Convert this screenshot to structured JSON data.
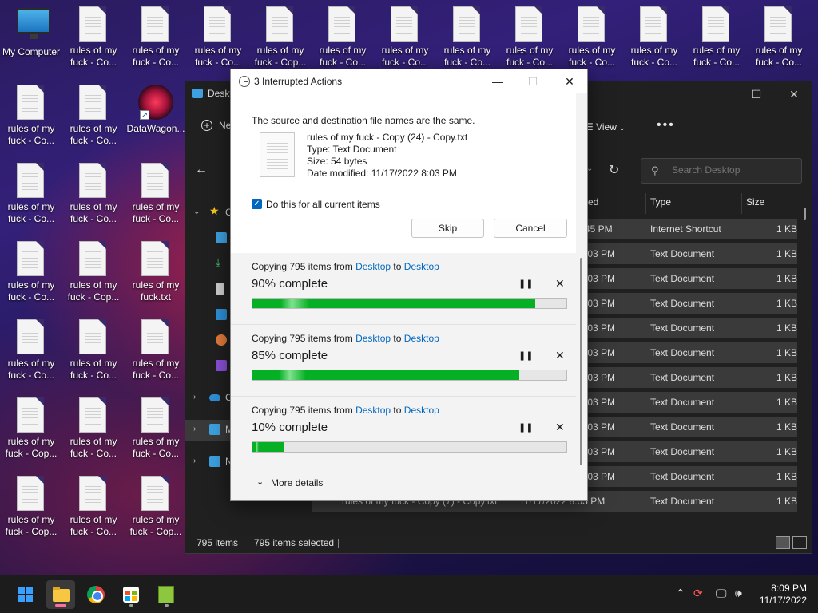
{
  "desktop": {
    "icons": [
      {
        "label": "My Computer",
        "icon": "computer-icon"
      },
      {
        "label": "rules of my fuck - Co...",
        "icon": "text-file-icon"
      },
      {
        "label": "rules of my fuck - Co...",
        "icon": "text-file-icon"
      },
      {
        "label": "rules of my fuck - Co...",
        "icon": "text-file-icon"
      },
      {
        "label": "rules of my fuck - Cop...",
        "icon": "text-file-icon"
      },
      {
        "label": "rules of my fuck - Co...",
        "icon": "text-file-icon"
      },
      {
        "label": "rules of my fuck - Co...",
        "icon": "text-file-icon"
      },
      {
        "label": "rules of my fuck - Co...",
        "icon": "text-file-icon"
      },
      {
        "label": "rules of my fuck - Co...",
        "icon": "text-file-icon"
      },
      {
        "label": "rules of my fuck - Co...",
        "icon": "text-file-icon"
      },
      {
        "label": "rules of my fuck - Co...",
        "icon": "text-file-icon"
      },
      {
        "label": "rules of my fuck - Co...",
        "icon": "text-file-icon"
      },
      {
        "label": "rules of my fuck - Co...",
        "icon": "text-file-icon"
      },
      {
        "label": "rules of my fuck - Co...",
        "icon": "text-file-icon"
      },
      {
        "label": "rules of my fuck - Co...",
        "icon": "text-file-icon"
      },
      {
        "label": "DataWagon...",
        "icon": "datawagon-shortcut-icon"
      },
      {
        "label": "rules of my fuck - Co...",
        "icon": "text-file-icon"
      },
      {
        "label": "rules of my fuck - Co...",
        "icon": "text-file-icon"
      },
      {
        "label": "rules of my fuck - Co...",
        "icon": "text-file-icon"
      },
      {
        "label": "rules of my fuck - Co...",
        "icon": "text-file-icon"
      },
      {
        "label": "rules of my fuck - Cop...",
        "icon": "text-file-icon"
      },
      {
        "label": "rules of my fuck.txt",
        "icon": "text-file-icon"
      },
      {
        "label": "rules of my fuck - Co...",
        "icon": "text-file-icon"
      },
      {
        "label": "rules of my fuck - Co...",
        "icon": "text-file-icon"
      },
      {
        "label": "rules of my fuck - Co...",
        "icon": "text-file-icon"
      },
      {
        "label": "rules of my fuck - Cop...",
        "icon": "text-file-icon"
      },
      {
        "label": "rules of my fuck - Co...",
        "icon": "text-file-icon"
      },
      {
        "label": "rules of my fuck - Co...",
        "icon": "text-file-icon"
      },
      {
        "label": "rules of my fuck - Cop...",
        "icon": "text-file-icon"
      },
      {
        "label": "rules of my fuck - Co...",
        "icon": "text-file-icon"
      },
      {
        "label": "rules of my fuck - Cop...",
        "icon": "text-file-icon"
      }
    ]
  },
  "explorer": {
    "title": "Deskt",
    "new_label": "Ne",
    "view_label": "View",
    "more_label": "•••",
    "search_placeholder": "Search Desktop",
    "sidebar_items": [
      "C",
      "C",
      "M",
      "N"
    ],
    "columns": {
      "date": "ed",
      "type": "Type",
      "size": "Size"
    },
    "rows": [
      {
        "name": "",
        "date": "45 PM",
        "type": "Internet Shortcut",
        "size": "1 KB"
      },
      {
        "name": "",
        "date": ":03 PM",
        "type": "Text Document",
        "size": "1 KB"
      },
      {
        "name": "",
        "date": ":03 PM",
        "type": "Text Document",
        "size": "1 KB"
      },
      {
        "name": "",
        "date": ":03 PM",
        "type": "Text Document",
        "size": "1 KB"
      },
      {
        "name": "",
        "date": ":03 PM",
        "type": "Text Document",
        "size": "1 KB"
      },
      {
        "name": "",
        "date": ":03 PM",
        "type": "Text Document",
        "size": "1 KB"
      },
      {
        "name": "",
        "date": ":03 PM",
        "type": "Text Document",
        "size": "1 KB"
      },
      {
        "name": "",
        "date": ":03 PM",
        "type": "Text Document",
        "size": "1 KB"
      },
      {
        "name": "",
        "date": ":03 PM",
        "type": "Text Document",
        "size": "1 KB"
      },
      {
        "name": "",
        "date": ":03 PM",
        "type": "Text Document",
        "size": "1 KB"
      },
      {
        "name": "",
        "date": ":03 PM",
        "type": "Text Document",
        "size": "1 KB"
      },
      {
        "name": "rules of my fuck - Copy (7) - Copy.txt",
        "date": "11/17/2022 8:03 PM",
        "type": "Text Document",
        "size": "1 KB"
      }
    ],
    "status_count": "795 items",
    "status_selected": "795 items selected"
  },
  "dialog": {
    "title": "3 Interrupted Actions",
    "message": "The source and destination file names are the same.",
    "file_name": "rules of my fuck - Copy (24) - Copy.txt",
    "file_type": "Type: Text Document",
    "file_size": "Size: 54 bytes",
    "file_modified": "Date modified: 11/17/2022 8:03 PM",
    "checkbox_label": "Do this for all current items",
    "checkbox_checked": true,
    "skip_label": "Skip",
    "cancel_label": "Cancel",
    "operations": [
      {
        "prefix": "Copying 795 items from ",
        "source": "Desktop",
        "to": " to ",
        "dest": "Desktop",
        "percent_label": "90% complete",
        "progress": 0.9
      },
      {
        "prefix": "Copying 795 items from ",
        "source": "Desktop",
        "to": " to ",
        "dest": "Desktop",
        "percent_label": "85% complete",
        "progress": 0.85
      },
      {
        "prefix": "Copying 795 items from ",
        "source": "Desktop",
        "to": " to ",
        "dest": "Desktop",
        "percent_label": "10% complete",
        "progress": 0.1
      }
    ],
    "more_details_label": "More details"
  },
  "taskbar": {
    "time": "8:09 PM",
    "date": "11/17/2022"
  },
  "colors": {
    "progress_green": "#06b025",
    "link_blue": "#0067c0",
    "checkbox_blue": "#0067c0"
  }
}
